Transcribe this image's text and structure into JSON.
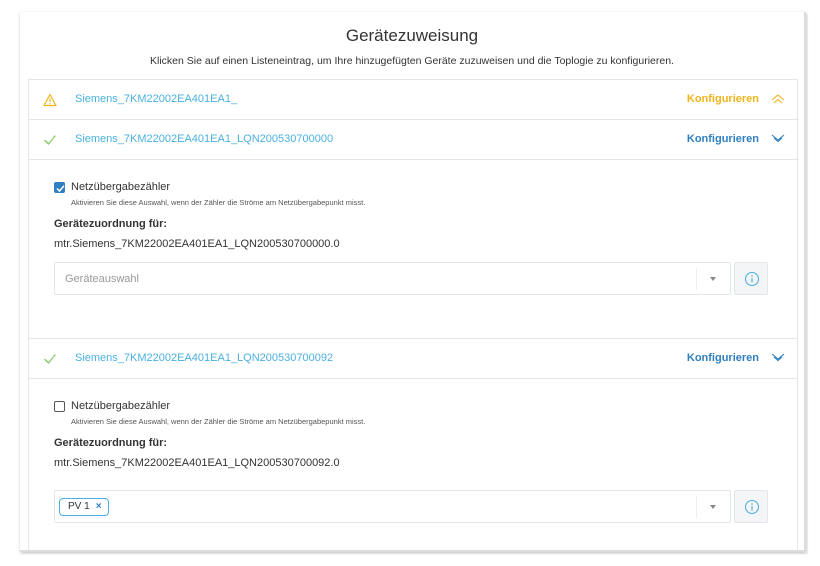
{
  "header": {
    "title": "Gerätezuweisung",
    "subtitle": "Klicken Sie auf einen Listeneintrag, um Ihre hinzugefügten Geräte zuzuweisen und die Toplogie zu konfigurieren."
  },
  "devices": [
    {
      "name": "Siemens_7KM22002EA401EA1_",
      "status": "warning",
      "configure_label": "Konfigurieren"
    },
    {
      "name": "Siemens_7KM22002EA401EA1_LQN200530700000",
      "status": "ok",
      "configure_label": "Konfigurieren",
      "checkbox_label": "Netzübergabezähler",
      "checkbox_hint": "Aktivieren Sie diese Auswahl, wenn der Zähler die Ströme am Netzübergabepunkt misst.",
      "checked": true,
      "mapping_label": "Gerätezuordnung für:",
      "mapping_value": "mtr.Siemens_7KM22002EA401EA1_LQN200530700000.0",
      "select_placeholder": "Geräteauswahl"
    },
    {
      "name": "Siemens_7KM22002EA401EA1_LQN200530700092",
      "status": "ok",
      "configure_label": "Konfigurieren",
      "checkbox_label": "Netzübergabezähler",
      "checkbox_hint": "Aktivieren Sie diese Auswahl, wenn der Zähler die Ströme am Netzübergabepunkt misst.",
      "checked": false,
      "mapping_label": "Gerätezuordnung für:",
      "mapping_value": "mtr.Siemens_7KM22002EA401EA1_LQN200530700092.0",
      "selected_tag": "PV 1",
      "tag_remove": "×"
    }
  ],
  "colors": {
    "accent": "#2f7fc1",
    "link": "#4ab0e0",
    "warning": "#f0b41c",
    "ok": "#7cc45a"
  },
  "icons": {
    "warning": "warning-triangle-icon",
    "ok": "check-icon",
    "expand": "double-chevron-icon",
    "info": "info-circle-icon"
  }
}
